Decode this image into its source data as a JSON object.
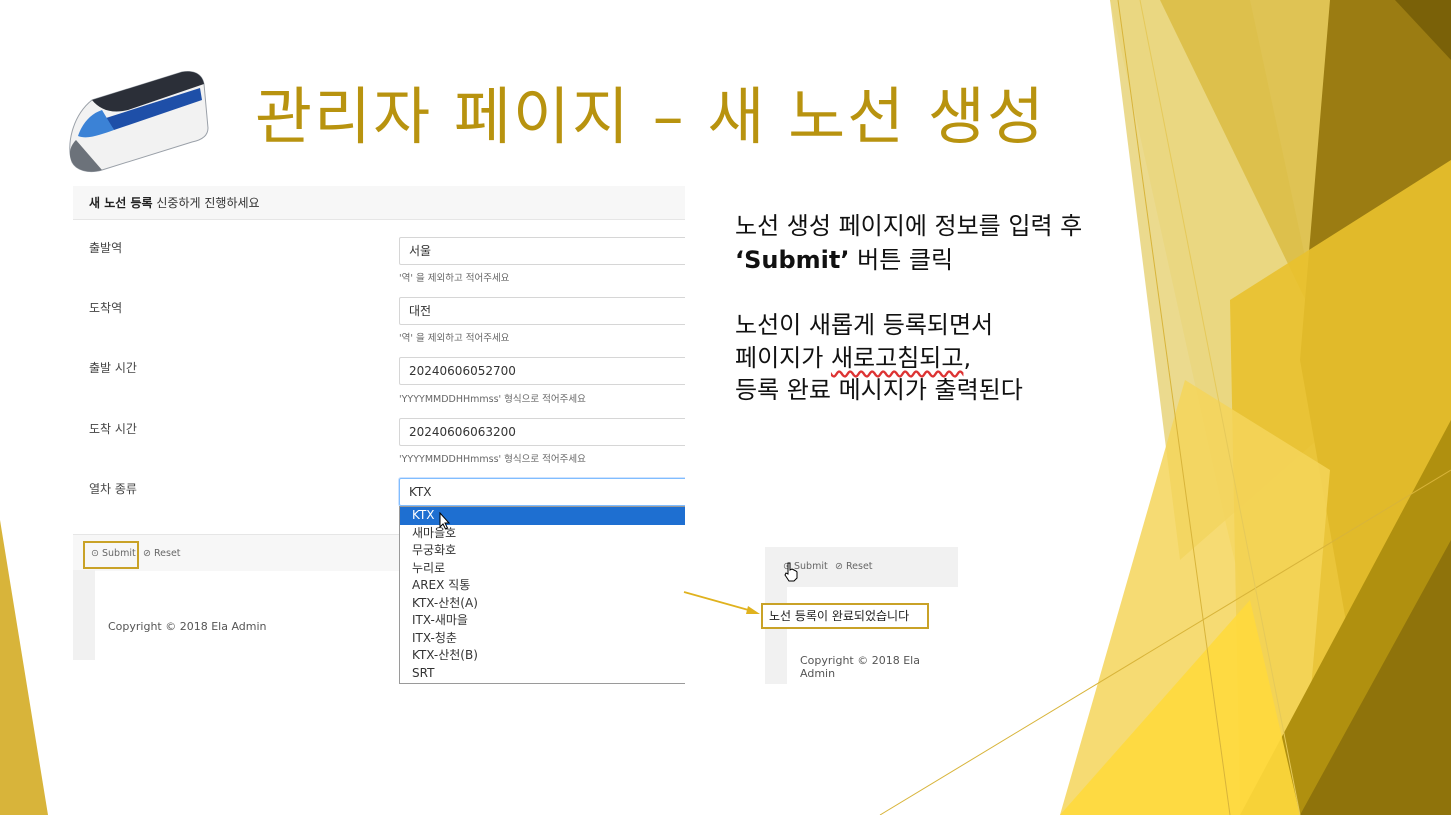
{
  "slide": {
    "title": "관리자 페이지 – 새 노선 생성",
    "colors": {
      "title": "#b8930f",
      "highlight_border": "#c9a227",
      "selected_option": "#1e6fd1"
    },
    "train_image_icon": "ktx-train-illustration"
  },
  "form": {
    "header_bold": "새 노선 등록",
    "header_rest": "신중하게 진행하세요",
    "fields": [
      {
        "label": "출발역",
        "value": "서울",
        "help": "'역' 을 제외하고 적어주세요"
      },
      {
        "label": "도착역",
        "value": "대전",
        "help": "'역' 을 제외하고 적어주세요"
      },
      {
        "label": "출발 시간",
        "value": "20240606052700",
        "help": "'YYYYMMDDHHmmss' 형식으로 적어주세요"
      },
      {
        "label": "도착 시간",
        "value": "20240606063200",
        "help": "'YYYYMMDDHHmmss' 형식으로 적어주세요"
      }
    ],
    "train_type": {
      "label": "열차 종류",
      "selected": "KTX",
      "options": [
        "KTX",
        "새마을호",
        "무궁화호",
        "누리로",
        "AREX 직통",
        "KTX-산천(A)",
        "ITX-새마을",
        "ITX-청춘",
        "KTX-산천(B)",
        "SRT"
      ]
    },
    "submit_label": "Submit",
    "reset_label": "Reset",
    "copyright": "Copyright © 2018 Ela Admin"
  },
  "description": {
    "line1": "노선 생성 페이지에 정보를 입력 후",
    "line2_bold": "‘Submit’",
    "line2_rest": " 버튼 클릭",
    "line3": "노선이 새롭게 등록되면서",
    "line4_a": "페이지가 ",
    "line4_b": "새로고침되고",
    "line4_c": ",",
    "line5": "등록 완료 메시지가 출력된다"
  },
  "result": {
    "submit_label": "Submit",
    "reset_label": "Reset",
    "message": "노선 등록이 완료되었습니다",
    "copyright": "Copyright © 2018 Ela Admin"
  }
}
